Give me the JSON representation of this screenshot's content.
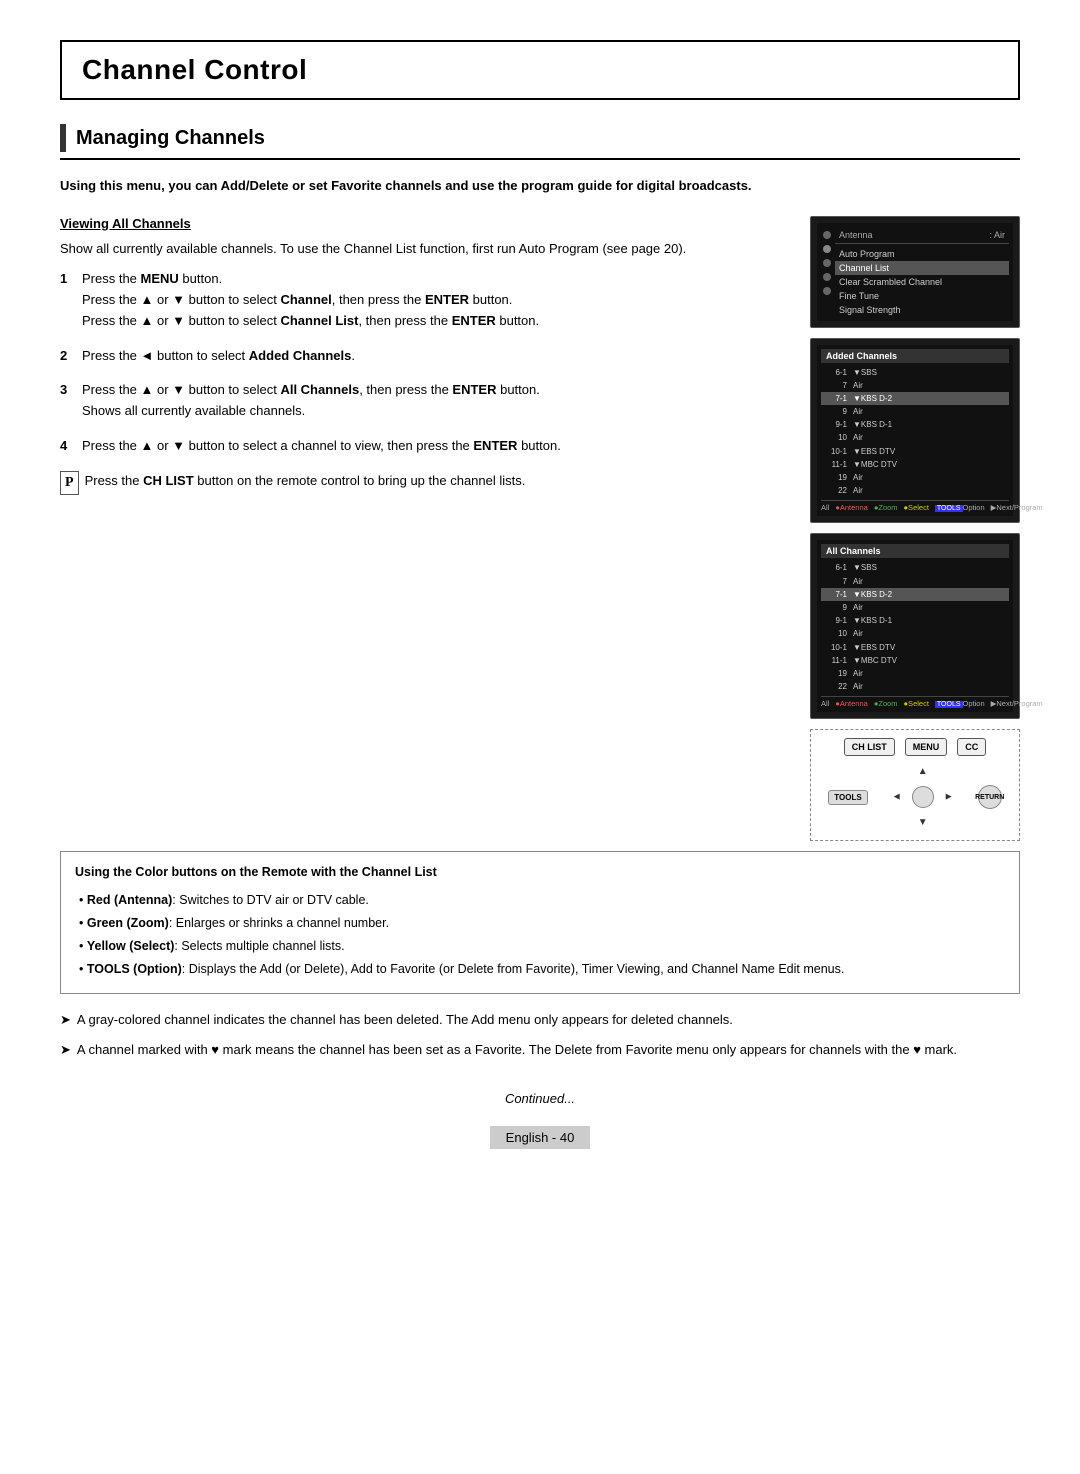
{
  "page": {
    "title": "Channel Control",
    "section_title": "Managing Channels",
    "intro_text": "Using this menu, you can Add/Delete or set Favorite channels and use the program guide for digital broadcasts.",
    "subheading_viewing": "Viewing All Channels",
    "body_text_1": "Show all currently available channels. To use the Channel List function, first run Auto Program (see page 20).",
    "steps": [
      {
        "num": "1",
        "lines": [
          "Press the MENU button.",
          "Press the ▲ or ▼ button to select Channel, then press the ENTER button.",
          "Press the ▲ or ▼ button to select Channel List, then press the ENTER button."
        ]
      },
      {
        "num": "2",
        "lines": [
          "Press the ◄ button to select Added Channels."
        ]
      },
      {
        "num": "3",
        "lines": [
          "Press the ▲ or ▼ button to select All Channels, then press the ENTER button.",
          "Shows all currently available channels."
        ]
      },
      {
        "num": "4",
        "lines": [
          "Press the ▲ or ▼ button to select a channel to view, then press the ENTER button."
        ]
      }
    ],
    "ch_list_note": "Press the CH LIST button on the remote control to bring up the channel lists.",
    "color_box_title": "Using the Color buttons on the Remote with the Channel List",
    "color_bullets": [
      "Red (Antenna): Switches to DTV air or DTV cable.",
      "Green (Zoom): Enlarges or shrinks a channel number.",
      "Yellow (Select): Selects multiple channel lists.",
      "TOOLS (Option): Displays the Add (or Delete), Add to Favorite (or Delete from Favorite), Timer Viewing, and Channel Name Edit menus."
    ],
    "notes": [
      "A gray-colored channel indicates the channel has been deleted. The Add menu only appears for deleted channels.",
      "A channel marked with ♥ mark means the channel has been set as a Favorite. The Delete from Favorite menu only appears for channels with the ♥ mark."
    ],
    "continued": "Continued...",
    "footer_text": "English - 40"
  },
  "tv_menu": {
    "antenna_label": "Antenna",
    "antenna_value": ": Air",
    "auto_program": "Auto Program",
    "channel_list": "Channel List",
    "clear_scrambled": "Clear Scrambled Channel",
    "fine_tune": "Fine Tune",
    "signal_strength": "Signal Strength"
  },
  "channel_list_1": {
    "title": "Added Channels",
    "rows": [
      {
        "num": "6-1",
        "name": "▼SBS",
        "highlight": false
      },
      {
        "num": "7",
        "name": "Air",
        "highlight": false
      },
      {
        "num": "7-1",
        "name": "▼KBS D-2",
        "highlight": true
      },
      {
        "num": "9",
        "name": "Air",
        "highlight": false
      },
      {
        "num": "9-1",
        "name": "▼KBS D-1",
        "highlight": false
      },
      {
        "num": "10",
        "name": "Air",
        "highlight": false
      },
      {
        "num": "10-1",
        "name": "▼EBS DTV",
        "highlight": false
      },
      {
        "num": "11-1",
        "name": "▼MBC DTV",
        "highlight": false
      },
      {
        "num": "19",
        "name": "Air",
        "highlight": false
      },
      {
        "num": "22",
        "name": "Air",
        "highlight": false
      }
    ],
    "bottom": [
      "All",
      "●Antenna",
      "●Zoom",
      "●Select",
      "TOOLS Option",
      "▶Next/Program"
    ]
  },
  "channel_list_2": {
    "title": "All Channels",
    "rows": [
      {
        "num": "6-1",
        "name": "▼SBS",
        "highlight": false
      },
      {
        "num": "7",
        "name": "Air",
        "highlight": false
      },
      {
        "num": "7-1",
        "name": "▼KBS D-2",
        "highlight": true
      },
      {
        "num": "9",
        "name": "Air",
        "highlight": false
      },
      {
        "num": "9-1",
        "name": "▼KBS D-1",
        "highlight": false
      },
      {
        "num": "10",
        "name": "Air",
        "highlight": false
      },
      {
        "num": "10-1",
        "name": "▼EBS DTV",
        "highlight": false
      },
      {
        "num": "11-1",
        "name": "▼MBC DTV",
        "highlight": false
      },
      {
        "num": "19",
        "name": "Air",
        "highlight": false
      },
      {
        "num": "22",
        "name": "Air",
        "highlight": false
      }
    ],
    "bottom": [
      "All",
      "●Antenna",
      "●Zoom",
      "●Select",
      "TOOLS Option",
      "▶Next/Program"
    ]
  },
  "remote": {
    "ch_list_label": "CH LIST",
    "menu_label": "MENU",
    "cc_label": "CC",
    "tools_label": "TOOLS",
    "return_label": "RETURN"
  }
}
